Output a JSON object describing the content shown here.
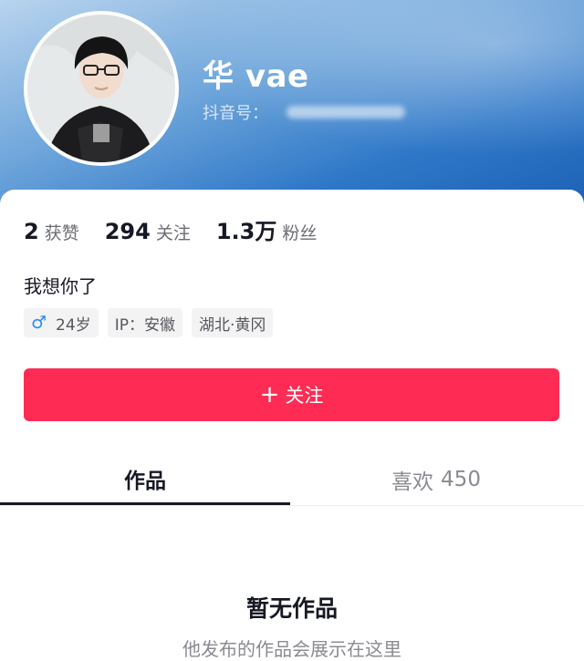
{
  "profile": {
    "username": "华 vae",
    "douyin_id_label": "抖音号：",
    "bio": "我想你了"
  },
  "stats": [
    {
      "value": "2",
      "label": "获赞"
    },
    {
      "value": "294",
      "label": "关注"
    },
    {
      "value": "1.3万",
      "label": "粉丝"
    }
  ],
  "tags": {
    "gender_icon": "♂",
    "age": "24岁",
    "ip": "IP：安徽",
    "location": "湖北·黄冈"
  },
  "follow_button": {
    "icon": "+",
    "label": "关注"
  },
  "tabs": [
    {
      "label": "作品",
      "count": ""
    },
    {
      "label": "喜欢",
      "count": "450"
    }
  ],
  "empty_state": {
    "title": "暂无作品",
    "subtitle": "他发布的作品会展示在这里"
  },
  "colors": {
    "accent": "#fe2c55",
    "header_blue": "#2f78c8",
    "gender_blue": "#2f8cf0"
  }
}
